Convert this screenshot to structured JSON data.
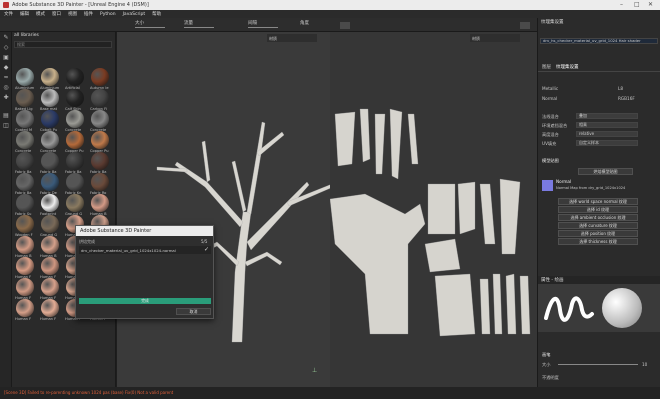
{
  "window": {
    "title": "Adobe Substance 3D Painter - [Unreal Engine 4 (DSM)]"
  },
  "menu": [
    "文件",
    "编辑",
    "模式",
    "窗口",
    "视图",
    "插件",
    "Python",
    "JavaScript",
    "帮助"
  ],
  "toolbar": {
    "size_label": "大小",
    "flow_label": "流量",
    "spacing_label": "间隔",
    "size_val": "1",
    "viewport_mode": "材质",
    "uv_mode": "材质"
  },
  "shelf": {
    "title": "all libraries",
    "search_placeholder": "搜索",
    "items": [
      "Aluminium",
      "Aluminium",
      "Artificial",
      "Autumn le",
      "Baked Lig",
      "Base mat",
      "Calf Skin",
      "Carbon Fi",
      "Coated M",
      "Cobalt Pu",
      "Concrete",
      "Concrete",
      "Concrete",
      "Concrete",
      "Copper Pu",
      "Copper Pu",
      "Fabric Ba",
      "Fabric Ba",
      "Fabric Ba",
      "Fabric Ba",
      "Fabric Ba",
      "Fabric De",
      "Fabric Kn",
      "Fabric Ro",
      "Fabric Su",
      "Footprint",
      "Ground G",
      "Human B",
      "Wooden F",
      "Ground G",
      "Human B",
      "Human B",
      "Human B",
      "Human B",
      "Human B",
      "Human B",
      "Human F",
      "Human F",
      "Human F",
      "Human F",
      "Human F",
      "Human F",
      "Human F",
      "Human F",
      "Human F",
      "Human F",
      "Human F",
      "Human F"
    ]
  },
  "rightpanel": {
    "title": "纹理集设置",
    "tab_a": "图层",
    "tab_b": "纹理集设置",
    "texture_name": "drv_hs_checker_material_uv_grid_1024 Hair shader",
    "channels": [
      {
        "name": "Metallic",
        "val": "L8"
      },
      {
        "name": "Normal",
        "val": "RGB16F"
      }
    ],
    "normal_mix_label": "法线混合",
    "normal_mix_val": "叠加",
    "ao_mix_label": "环境遮挡混合",
    "ao_mix_val": "相乘",
    "height_label": "高度混合",
    "height_val": "relative",
    "uv_label": "UV填充",
    "uv_val": "自定义样本",
    "bake_title": "模型贴图",
    "bake_btn": "烘焙模型贴图",
    "normal_title": "Normal",
    "normal_sub": "Normal Map from dry_grid_1024x1024",
    "map_btns": [
      "选择 world space normal 纹理",
      "选择 id 纹理",
      "选择 ambient occlusion 纹理",
      "选择 curvature 纹理",
      "选择 position 纹理",
      "选择 thickness 纹理"
    ],
    "props_title": "属性 - 绘画",
    "props_sec": "画笔",
    "size_label": "大小",
    "size_val": "10",
    "opacity_label": "不透明度"
  },
  "dialog": {
    "title": "Adobe Substance 3D Painter",
    "status": "烘焙完成",
    "item": "drv_checker_material_uv_grid_1024x1024-normal",
    "pct": "5/5",
    "progress": 1.0,
    "progress_label": "完成",
    "cancel": "取消"
  },
  "status": {
    "message": "[Scene 3D] Failed to re-parenting unknown 1024 pas (base) Fix(0) Not a valid parent"
  }
}
